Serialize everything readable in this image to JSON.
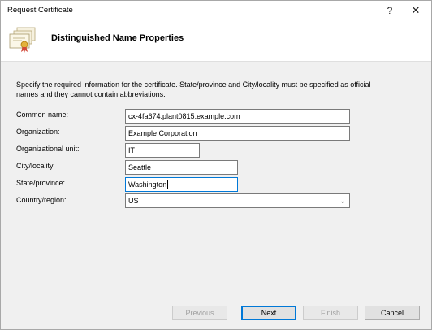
{
  "window": {
    "title": "Request Certificate",
    "help_label": "?",
    "close_label": "✕"
  },
  "header": {
    "title": "Distinguished Name Properties"
  },
  "instructions": "Specify the required information for the certificate. State/province and City/locality must be specified as official names and they cannot contain abbreviations.",
  "form": {
    "common_name": {
      "label": "Common name:",
      "value": "cx-4fa674.plant0815.example.com"
    },
    "organization": {
      "label": "Organization:",
      "value": "Example Corporation"
    },
    "organizational_unit": {
      "label": "Organizational unit:",
      "value": "IT"
    },
    "city": {
      "label": "City/locality",
      "value": "Seattle"
    },
    "state": {
      "label": "State/province:",
      "value": "Washington"
    },
    "country": {
      "label": "Country/region:",
      "value": "US"
    }
  },
  "buttons": {
    "previous": "Previous",
    "next": "Next",
    "finish": "Finish",
    "cancel": "Cancel"
  },
  "colors": {
    "focus": "#0078d7",
    "dialog_bg": "#f0f0f0"
  }
}
